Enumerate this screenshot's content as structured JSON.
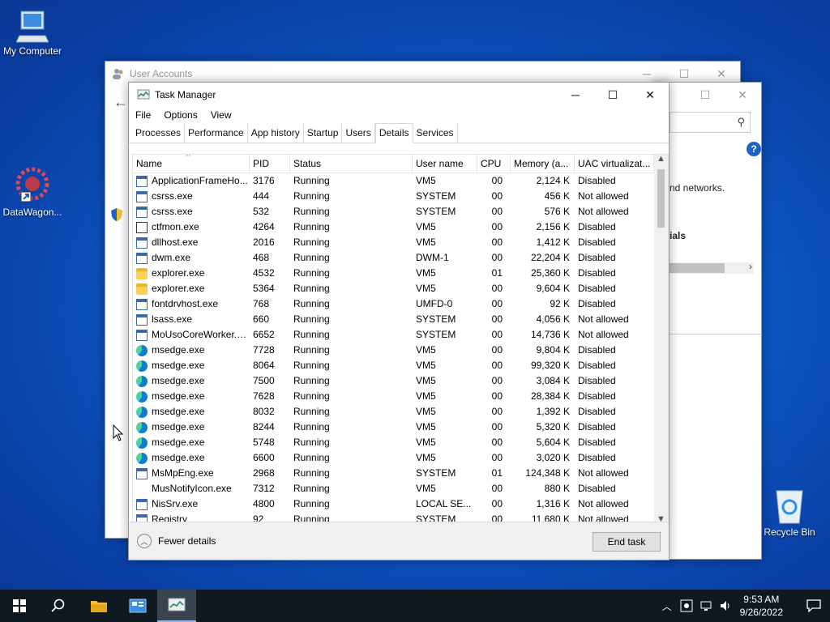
{
  "desktop": {
    "icons": [
      {
        "label": "My Computer",
        "icon": "computer-icon"
      },
      {
        "label": "DataWagon...",
        "icon": "datawagon-icon"
      },
      {
        "label": "Recycle Bin",
        "icon": "recycle-bin-icon"
      }
    ]
  },
  "user_accounts": {
    "title": "User Accounts",
    "text_networks": "nd networks.",
    "text_als": "ials"
  },
  "task_manager": {
    "title": "Task Manager",
    "menu": [
      "File",
      "Options",
      "View"
    ],
    "tabs": [
      "Processes",
      "Performance",
      "App history",
      "Startup",
      "Users",
      "Details",
      "Services"
    ],
    "active_tab": "Details",
    "columns": [
      "Name",
      "PID",
      "Status",
      "User name",
      "CPU",
      "Memory (a...",
      "UAC virtualizat..."
    ],
    "rows": [
      {
        "icon": "app",
        "name": "ApplicationFrameHo...",
        "pid": "3176",
        "status": "Running",
        "user": "VM5",
        "cpu": "00",
        "mem": "2,124 K",
        "uac": "Disabled"
      },
      {
        "icon": "app",
        "name": "csrss.exe",
        "pid": "444",
        "status": "Running",
        "user": "SYSTEM",
        "cpu": "00",
        "mem": "456 K",
        "uac": "Not allowed"
      },
      {
        "icon": "app",
        "name": "csrss.exe",
        "pid": "532",
        "status": "Running",
        "user": "SYSTEM",
        "cpu": "00",
        "mem": "576 K",
        "uac": "Not allowed"
      },
      {
        "icon": "pen",
        "name": "ctfmon.exe",
        "pid": "4264",
        "status": "Running",
        "user": "VM5",
        "cpu": "00",
        "mem": "2,156 K",
        "uac": "Disabled"
      },
      {
        "icon": "app",
        "name": "dllhost.exe",
        "pid": "2016",
        "status": "Running",
        "user": "VM5",
        "cpu": "00",
        "mem": "1,412 K",
        "uac": "Disabled"
      },
      {
        "icon": "app",
        "name": "dwm.exe",
        "pid": "468",
        "status": "Running",
        "user": "DWM-1",
        "cpu": "00",
        "mem": "22,204 K",
        "uac": "Disabled"
      },
      {
        "icon": "folder",
        "name": "explorer.exe",
        "pid": "4532",
        "status": "Running",
        "user": "VM5",
        "cpu": "01",
        "mem": "25,360 K",
        "uac": "Disabled"
      },
      {
        "icon": "folder",
        "name": "explorer.exe",
        "pid": "5364",
        "status": "Running",
        "user": "VM5",
        "cpu": "00",
        "mem": "9,604 K",
        "uac": "Disabled"
      },
      {
        "icon": "app",
        "name": "fontdrvhost.exe",
        "pid": "768",
        "status": "Running",
        "user": "UMFD-0",
        "cpu": "00",
        "mem": "92 K",
        "uac": "Disabled"
      },
      {
        "icon": "app",
        "name": "lsass.exe",
        "pid": "660",
        "status": "Running",
        "user": "SYSTEM",
        "cpu": "00",
        "mem": "4,056 K",
        "uac": "Not allowed"
      },
      {
        "icon": "app",
        "name": "MoUsoCoreWorker.e...",
        "pid": "6652",
        "status": "Running",
        "user": "SYSTEM",
        "cpu": "00",
        "mem": "14,736 K",
        "uac": "Not allowed"
      },
      {
        "icon": "edge",
        "name": "msedge.exe",
        "pid": "7728",
        "status": "Running",
        "user": "VM5",
        "cpu": "00",
        "mem": "9,804 K",
        "uac": "Disabled"
      },
      {
        "icon": "edge",
        "name": "msedge.exe",
        "pid": "8064",
        "status": "Running",
        "user": "VM5",
        "cpu": "00",
        "mem": "99,320 K",
        "uac": "Disabled"
      },
      {
        "icon": "edge",
        "name": "msedge.exe",
        "pid": "7500",
        "status": "Running",
        "user": "VM5",
        "cpu": "00",
        "mem": "3,084 K",
        "uac": "Disabled"
      },
      {
        "icon": "edge",
        "name": "msedge.exe",
        "pid": "7628",
        "status": "Running",
        "user": "VM5",
        "cpu": "00",
        "mem": "28,384 K",
        "uac": "Disabled"
      },
      {
        "icon": "edge",
        "name": "msedge.exe",
        "pid": "8032",
        "status": "Running",
        "user": "VM5",
        "cpu": "00",
        "mem": "1,392 K",
        "uac": "Disabled"
      },
      {
        "icon": "edge",
        "name": "msedge.exe",
        "pid": "8244",
        "status": "Running",
        "user": "VM5",
        "cpu": "00",
        "mem": "5,320 K",
        "uac": "Disabled"
      },
      {
        "icon": "edge",
        "name": "msedge.exe",
        "pid": "5748",
        "status": "Running",
        "user": "VM5",
        "cpu": "00",
        "mem": "5,604 K",
        "uac": "Disabled"
      },
      {
        "icon": "edge",
        "name": "msedge.exe",
        "pid": "6600",
        "status": "Running",
        "user": "VM5",
        "cpu": "00",
        "mem": "3,020 K",
        "uac": "Disabled"
      },
      {
        "icon": "app",
        "name": "MsMpEng.exe",
        "pid": "2968",
        "status": "Running",
        "user": "SYSTEM",
        "cpu": "01",
        "mem": "124,348 K",
        "uac": "Not allowed"
      },
      {
        "icon": "blank",
        "name": "MusNotifyIcon.exe",
        "pid": "7312",
        "status": "Running",
        "user": "VM5",
        "cpu": "00",
        "mem": "880 K",
        "uac": "Disabled"
      },
      {
        "icon": "app",
        "name": "NisSrv.exe",
        "pid": "4800",
        "status": "Running",
        "user": "LOCAL SE...",
        "cpu": "00",
        "mem": "1,316 K",
        "uac": "Not allowed"
      },
      {
        "icon": "app",
        "name": "Registry",
        "pid": "92",
        "status": "Running",
        "user": "SYSTEM",
        "cpu": "00",
        "mem": "11,680 K",
        "uac": "Not allowed"
      }
    ],
    "fewer_details": "Fewer details",
    "end_task": "End task"
  },
  "taskbar": {
    "time": "9:53 AM",
    "date": "9/26/2022"
  }
}
